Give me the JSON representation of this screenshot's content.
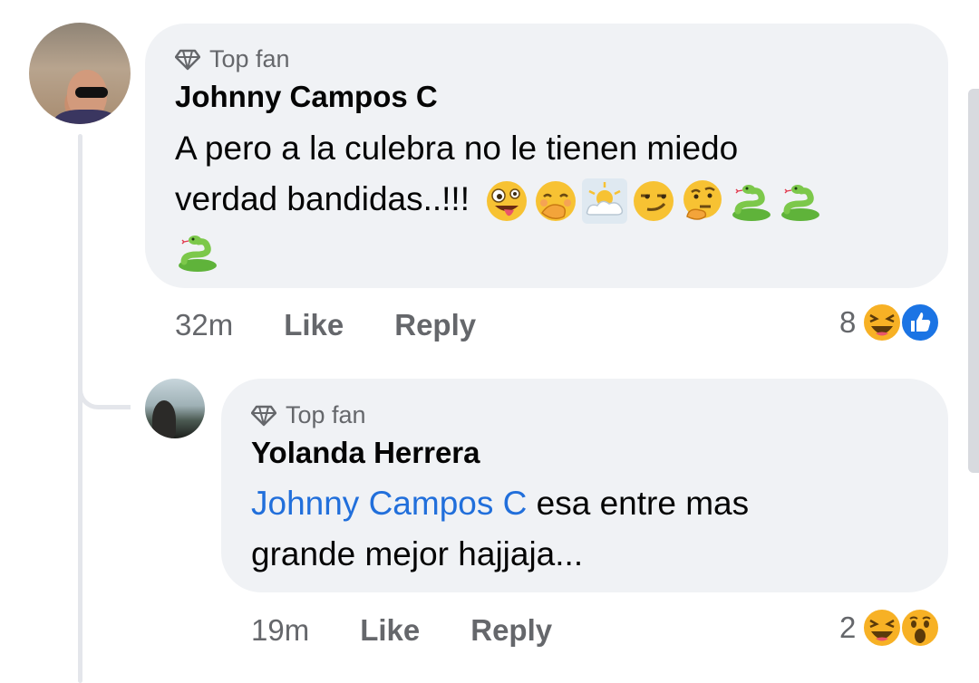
{
  "comments": [
    {
      "badge": "Top fan",
      "author": "Johnny Campos C",
      "text_line1": "A pero a la culebra no le tienen miedo",
      "text_line2": "verdad bandidas..!!!",
      "emojis_line2": [
        "zany-face-icon",
        "face-with-hand-over-mouth-icon",
        "sun-behind-cloud-icon",
        "smirk-face-icon",
        "thinking-face-icon",
        "snake-icon",
        "snake-icon"
      ],
      "emojis_line3": [
        "snake-icon"
      ],
      "time": "32m",
      "like_label": "Like",
      "reply_label": "Reply",
      "reaction_count": "8",
      "reactions": [
        "haha-icon",
        "like-icon"
      ]
    },
    {
      "badge": "Top fan",
      "author": "Yolanda Herrera",
      "mention": "Johnny Campos C",
      "text_line1_rest": " esa entre mas",
      "text_line2": "grande mejor hajjaja...",
      "time": "19m",
      "like_label": "Like",
      "reply_label": "Reply",
      "reaction_count": "2",
      "reactions": [
        "haha-icon",
        "wow-icon"
      ]
    }
  ],
  "colors": {
    "bubble": "#f0f2f5",
    "mention": "#216fdb",
    "secondary_text": "#65676b",
    "like_blue": "#1b74e4",
    "reaction_yellow": "#f7b125"
  }
}
